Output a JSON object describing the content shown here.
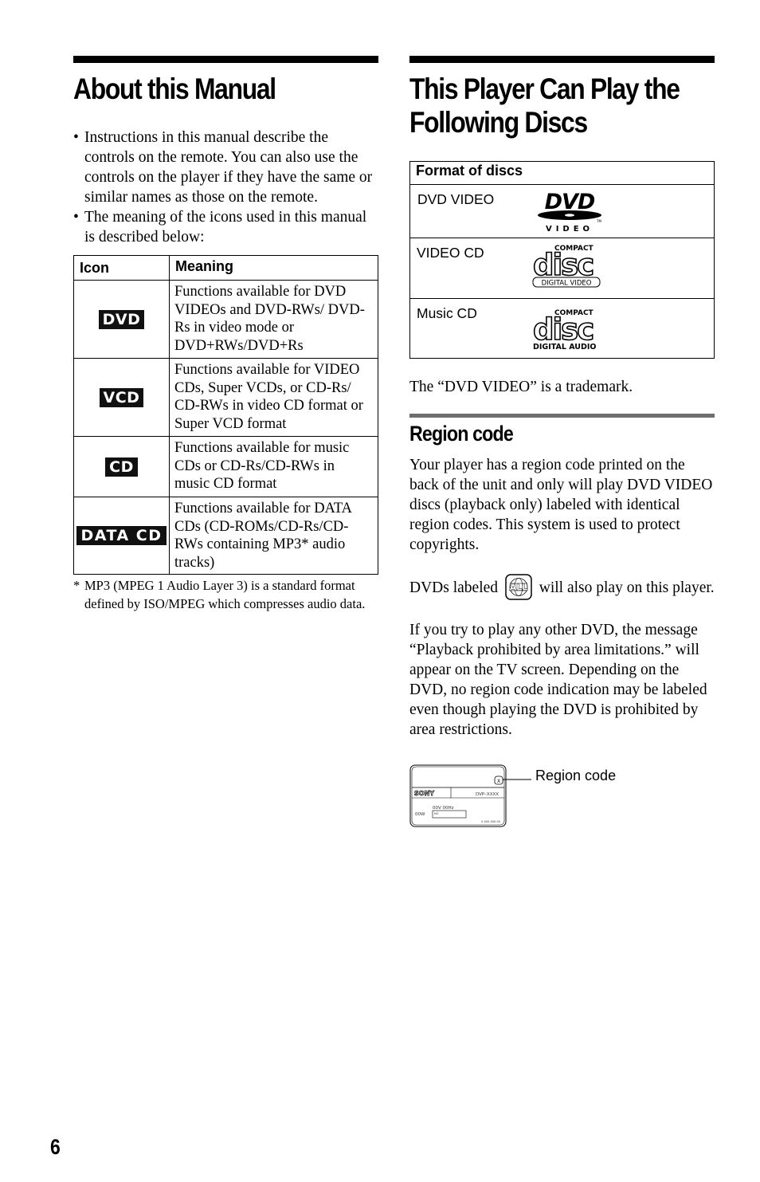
{
  "left_column": {
    "title": "About this Manual",
    "bullets": [
      "Instructions in this manual describe the controls on the remote. You can also use the controls on the player if they have the same or similar names as those on the remote.",
      "The meaning of the icons used in this manual is described below:"
    ],
    "icon_table": {
      "headers": [
        "Icon",
        "Meaning"
      ],
      "rows": [
        {
          "icon": "DVD",
          "icon_name": "dvd-badge-icon",
          "meaning": "Functions available for DVD VIDEOs and DVD-RWs/ DVD-Rs in video mode or DVD+RWs/DVD+Rs"
        },
        {
          "icon": "VCD",
          "icon_name": "vcd-badge-icon",
          "meaning": "Functions available for VIDEO CDs, Super VCDs, or CD-Rs/ CD-RWs in video CD format or Super VCD format"
        },
        {
          "icon": "CD",
          "icon_name": "cd-badge-icon",
          "meaning": "Functions available for music CDs or CD-Rs/CD-RWs in music CD format"
        },
        {
          "icon": "DATA CD",
          "icon_name": "data-cd-badge-icon",
          "meaning": "Functions available for DATA CDs (CD-ROMs/CD-Rs/CD-RWs containing MP3* audio tracks)"
        }
      ]
    },
    "footnote_marker": "*",
    "footnote": "MP3 (MPEG 1 Audio Layer 3) is a standard format defined by ISO/MPEG which compresses audio data."
  },
  "right_column": {
    "title": "This Player Can Play the Following Discs",
    "formats_table": {
      "header": "Format of discs",
      "rows": [
        {
          "label": "DVD VIDEO",
          "logo": "dvd-video-logo",
          "logo_text": "VIDEO"
        },
        {
          "label": "VIDEO CD",
          "logo": "compact-disc-digital-video-logo",
          "logo_top": "COMPACT",
          "logo_main": "disc",
          "logo_bottom": "DIGITAL VIDEO"
        },
        {
          "label": "Music CD",
          "logo": "compact-disc-digital-audio-logo",
          "logo_top": "COMPACT",
          "logo_main": "disc",
          "logo_bottom": "DIGITAL AUDIO"
        }
      ]
    },
    "trademark_note": "The “DVD VIDEO” is a trademark.",
    "region_section": {
      "title": "Region code",
      "para1": "Your player has a region code printed on the back of the unit and only will play DVD VIDEO discs (playback only) labeled with identical region codes. This system is used to protect copyrights.",
      "para2_before": "DVDs labeled",
      "all_mark_text": "ALL",
      "para2_after": "will also play on this player.",
      "para3": "If you try to play any other DVD, the message “Playback prohibited by area limitations.” will appear on the TV screen. Depending on the DVD, no region code indication may be labeled even though playing the DVD is prohibited by area restrictions.",
      "illustration": {
        "brand": "SONY",
        "model": "DVP–XXXX",
        "voltage": "00V 00Hz",
        "wattage": "00W",
        "serial_label": "NO.",
        "part_number": "0-000-000-00",
        "region_mark": "X",
        "callout": "Region code"
      }
    }
  },
  "page_number": "6"
}
